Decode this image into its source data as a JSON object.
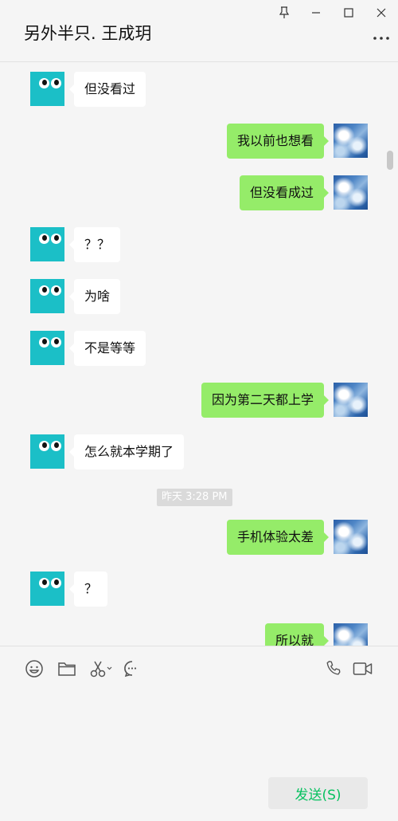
{
  "header": {
    "title": "另外半只. 王成玥"
  },
  "window_controls": [
    "pin-icon",
    "minimize-icon",
    "maximize-icon",
    "close-icon",
    "more-icon"
  ],
  "messages": [
    {
      "side": "in",
      "text": "但没看过"
    },
    {
      "side": "out",
      "text": "我以前也想看"
    },
    {
      "side": "out",
      "text": "但没看成过"
    },
    {
      "side": "in",
      "text": "？？"
    },
    {
      "side": "in",
      "text": "为啥"
    },
    {
      "side": "in",
      "text": "不是等等"
    },
    {
      "side": "out",
      "text": "因为第二天都上学"
    },
    {
      "side": "in",
      "text": "怎么就本学期了"
    },
    {
      "side": "out",
      "text": "手机体验太差"
    },
    {
      "side": "in",
      "text": "？"
    },
    {
      "side": "out",
      "text": "所以就"
    }
  ],
  "timestamp": "昨天 3:28 PM",
  "toolbar": {
    "left_icons": [
      "emoji-icon",
      "folder-icon",
      "scissors-icon",
      "chat-history-icon"
    ],
    "right_icons": [
      "phone-icon",
      "video-icon"
    ]
  },
  "input": {
    "value": "",
    "placeholder": ""
  },
  "send_button": {
    "label": "发送(S)"
  },
  "colors": {
    "outgoing_bubble": "#95ec69",
    "incoming_bubble": "#ffffff",
    "send_text": "#07c160",
    "avatar_robot": "#1bbfc7"
  }
}
